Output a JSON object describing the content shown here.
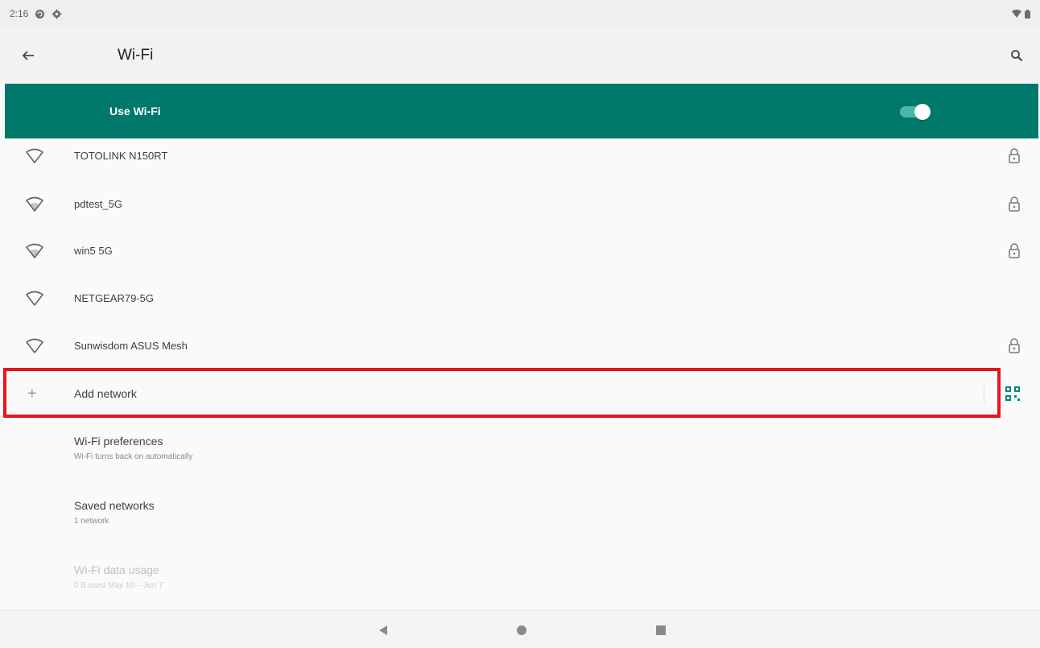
{
  "status_bar": {
    "time": "2:16",
    "icons": [
      "sync-circle-icon",
      "settings-gear-icon"
    ],
    "right_icons": [
      "wifi-signal-icon",
      "battery-icon"
    ]
  },
  "app_bar": {
    "back_icon": "arrow-back-icon",
    "title": "Wi-Fi",
    "search_icon": "search-icon"
  },
  "master_switch": {
    "label": "Use Wi-Fi",
    "enabled": true,
    "accent_color": "#00796b"
  },
  "networks": [
    {
      "name": "TOTOLINK N150RT",
      "secured": true
    },
    {
      "name": "pdtest_5G",
      "secured": true
    },
    {
      "name": "win5 5G",
      "secured": true
    },
    {
      "name": "NETGEAR79-5G",
      "secured": false
    },
    {
      "name": "Sunwisdom ASUS Mesh",
      "secured": true
    }
  ],
  "add_network": {
    "label": "Add network",
    "qr_icon": "qr-scan-icon"
  },
  "preferences": [
    {
      "title": "Wi-Fi preferences",
      "subtitle": "Wi-Fi turns back on automatically",
      "enabled": true
    },
    {
      "title": "Saved networks",
      "subtitle": "1 network",
      "enabled": true
    },
    {
      "title": "Wi-Fi data usage",
      "subtitle": "0 B used May 10 – Jun 7",
      "enabled": false
    }
  ],
  "nav_bar": {
    "back": "nav-back-icon",
    "home": "nav-home-icon",
    "recents": "nav-recents-icon"
  },
  "highlight_color": "#e8141b"
}
